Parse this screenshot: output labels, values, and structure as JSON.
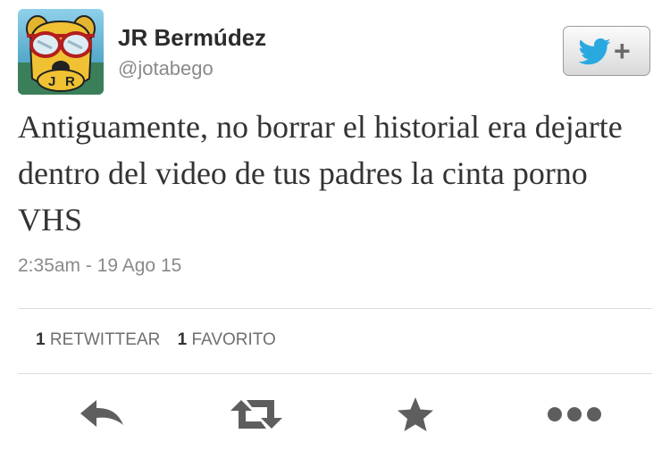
{
  "tweet": {
    "author_name": "JR Bermúdez",
    "author_handle": "@jotabego",
    "avatar": {
      "icon": "dog-with-sunglasses-avatar",
      "lettering": "JR"
    },
    "follow_button": {
      "icon": "twitter-bird-icon",
      "label": "+"
    },
    "text": "Antiguamente, no borrar el historial era dejarte dentro del video de tus padres la cinta porno VHS",
    "timestamp": "2:35am - 19 Ago 15",
    "stats": [
      {
        "count": "1",
        "label": "RETWITTEAR"
      },
      {
        "count": "1",
        "label": "FAVORITO"
      }
    ],
    "actions": [
      "reply-icon",
      "retweet-icon",
      "favorite-star-icon",
      "more-dots-icon"
    ]
  },
  "colors": {
    "text_primary": "#333333",
    "text_secondary": "#8a8a8a",
    "twitter_blue": "#2aa9e0",
    "icon_gray": "#646464",
    "divider": "#dcdcdc"
  }
}
